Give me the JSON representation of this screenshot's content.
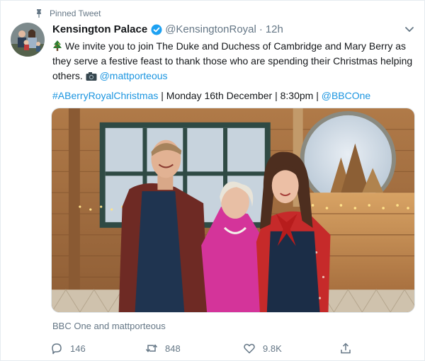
{
  "pinned_label": "Pinned Tweet",
  "account": {
    "name": "Kensington Palace",
    "handle": "@KensingtonRoyal",
    "separator": "·",
    "time": "12h"
  },
  "tweet": {
    "text_main": " We invite you to join The Duke and Duchess of Cambridge and Mary Berry as they serve a festive feast to thank those who are spending their Christmas helping others. ",
    "mention": "@mattporteous",
    "hashtag": "#ABerryRoyalChristmas",
    "schedule": " | Monday 16th December | 8:30pm | ",
    "channel_mention": "@BBCOne"
  },
  "media_credit": "BBC One and mattporteous",
  "actions": {
    "replies": "146",
    "retweets": "848",
    "likes": "9.8K"
  },
  "colors": {
    "link": "#1b95e0",
    "muted": "#657786",
    "verified": "#1da1f2"
  },
  "icons": [
    "pin-icon",
    "verified-icon",
    "chevron-down-icon",
    "tree-emoji-icon",
    "camera-emoji-icon",
    "reply-icon",
    "retweet-icon",
    "like-icon",
    "share-icon"
  ]
}
